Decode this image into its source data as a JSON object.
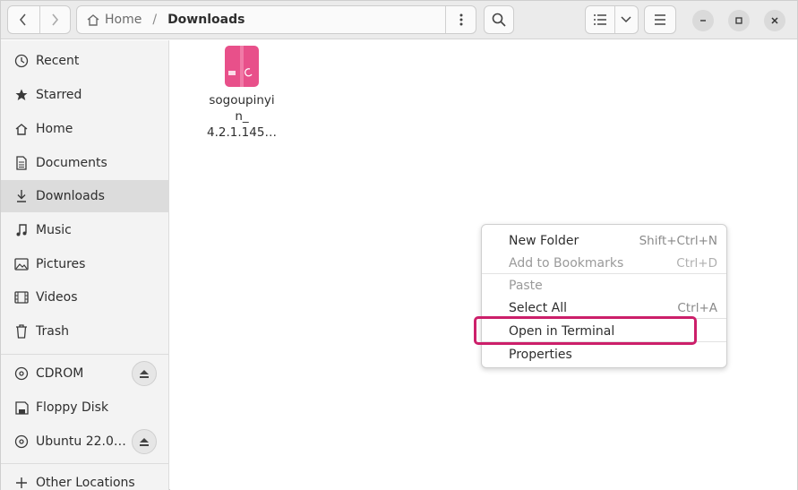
{
  "path": {
    "home_label": "Home",
    "separator": "/",
    "current": "Downloads"
  },
  "sidebar": {
    "items": [
      {
        "label": "Recent",
        "icon": "clock-icon"
      },
      {
        "label": "Starred",
        "icon": "star-icon"
      },
      {
        "label": "Home",
        "icon": "home-icon"
      },
      {
        "label": "Documents",
        "icon": "document-icon"
      },
      {
        "label": "Downloads",
        "icon": "download-icon"
      },
      {
        "label": "Music",
        "icon": "music-note-icon"
      },
      {
        "label": "Pictures",
        "icon": "picture-icon"
      },
      {
        "label": "Videos",
        "icon": "film-icon"
      },
      {
        "label": "Trash",
        "icon": "trash-icon"
      }
    ],
    "devices": [
      {
        "label": "CDROM",
        "icon": "disc-icon",
        "ejectable": true
      },
      {
        "label": "Floppy Disk",
        "icon": "floppy-icon",
        "ejectable": false
      },
      {
        "label": "Ubuntu 22.0…",
        "icon": "disc-icon",
        "ejectable": true
      }
    ],
    "other": {
      "label": "Other Locations",
      "icon": "plus-icon"
    }
  },
  "files": [
    {
      "name_line1": "sogoupinyi",
      "name_line2": "n_",
      "name_line3": "4.2.1.145…",
      "icon": "debian-package-icon"
    }
  ],
  "context_menu": {
    "items": [
      {
        "label": "New Folder",
        "accel": "Shift+Ctrl+N",
        "enabled": true
      },
      {
        "label": "Add to Bookmarks",
        "accel": "Ctrl+D",
        "enabled": false
      },
      {
        "label": "Paste",
        "accel": "",
        "enabled": false
      },
      {
        "label": "Select All",
        "accel": "Ctrl+A",
        "enabled": true
      },
      {
        "label": "Open in Terminal",
        "accel": "",
        "enabled": true
      },
      {
        "label": "Properties",
        "accel": "",
        "enabled": true
      }
    ]
  },
  "colors": {
    "highlight": "#cc1f6a",
    "package": "#e8508a"
  }
}
